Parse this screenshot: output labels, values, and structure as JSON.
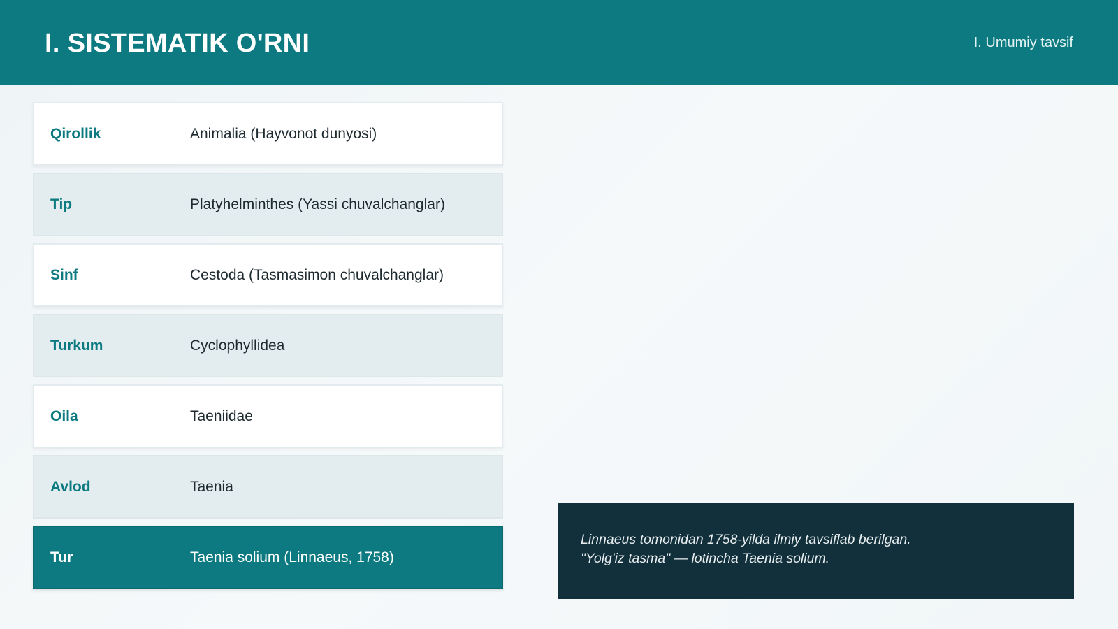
{
  "header": {
    "title": "I. SISTEMATIK O'RNI",
    "section": "I. Umumiy tavsif"
  },
  "taxonomy": [
    {
      "rank": "Qirollik",
      "name": "Animalia (Hayvonot dunyosi)"
    },
    {
      "rank": "Tip",
      "name": "Platyhelminthes (Yassi chuvalchanglar)"
    },
    {
      "rank": "Sinf",
      "name": "Cestoda (Tasmasimon chuvalchanglar)"
    },
    {
      "rank": "Turkum",
      "name": "Cyclophyllidea"
    },
    {
      "rank": "Oila",
      "name": "Taeniidae"
    },
    {
      "rank": "Avlod",
      "name": "Taenia"
    },
    {
      "rank": "Tur",
      "name": "Taenia solium (Linnaeus, 1758)"
    }
  ],
  "note": {
    "line1": "Linnaeus tomonidan 1758-yilda ilmiy tavsiflab berilgan.",
    "line2": "\"Yolg'iz tasma\" — lotincha Taenia solium."
  },
  "colors": {
    "accent": "#0c7a80",
    "note_background": "#12303b",
    "row_shaded": "#e3edf0",
    "page_background": "#f1f6f8"
  }
}
